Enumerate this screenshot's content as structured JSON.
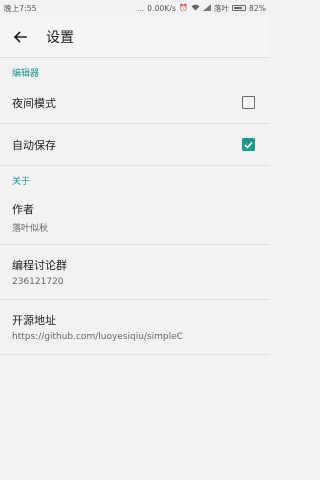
{
  "status_bar": {
    "time": "晚上7:55",
    "dots": "...",
    "speed": "0.00K/s",
    "carrier": "落叶",
    "battery": "82%",
    "battery_level": 0.82
  },
  "toolbar": {
    "title": "设置"
  },
  "sections": [
    {
      "header": "编辑器",
      "items": [
        {
          "title": "夜间模式",
          "checked": false
        },
        {
          "title": "自动保存",
          "checked": true
        }
      ]
    },
    {
      "header": "关于",
      "items": [
        {
          "title": "作者",
          "summary": "落叶似秋"
        },
        {
          "title": "编程讨论群",
          "summary": "236121720"
        },
        {
          "title": "开源地址",
          "summary": "https://github.com/luoyesiqiu/simpleC"
        }
      ]
    }
  ],
  "colors": {
    "accent": "#199a8f",
    "background": "#f2f2f2"
  }
}
